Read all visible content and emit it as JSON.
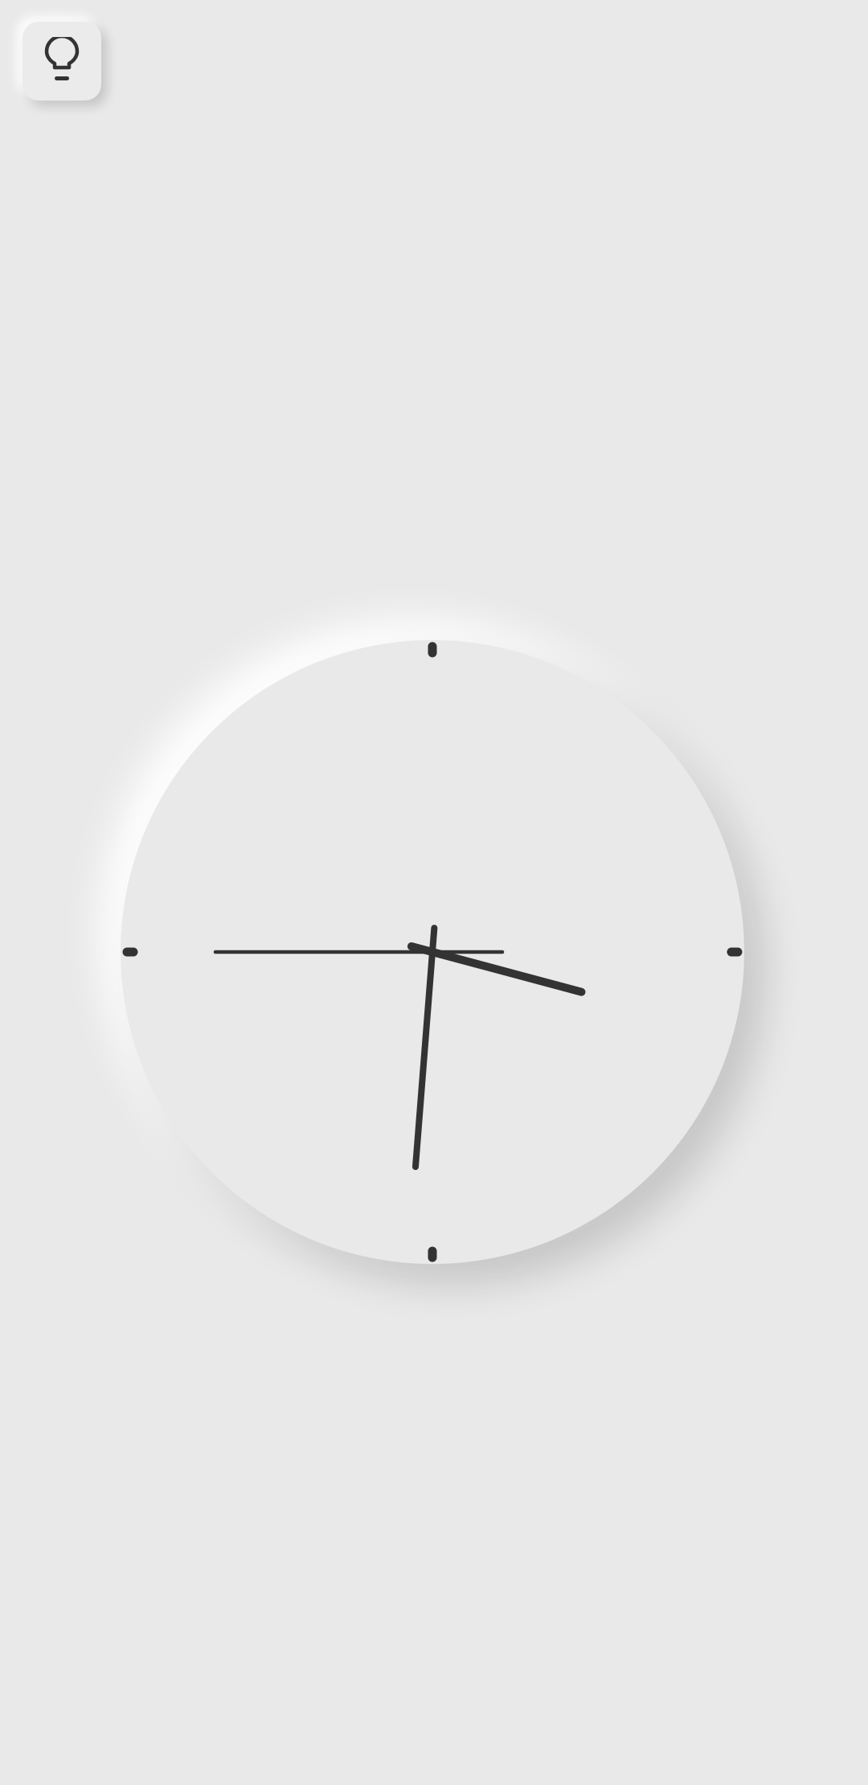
{
  "header": {
    "theme_toggle": {
      "icon": "lightbulb-icon"
    }
  },
  "clock": {
    "time": {
      "hour": 3,
      "minute": 30,
      "second": 45
    },
    "hour_markers": [
      12,
      3,
      6,
      9
    ],
    "colors": {
      "background": "#e9e9e9",
      "hands": "#333333",
      "markers": "#333333"
    }
  }
}
